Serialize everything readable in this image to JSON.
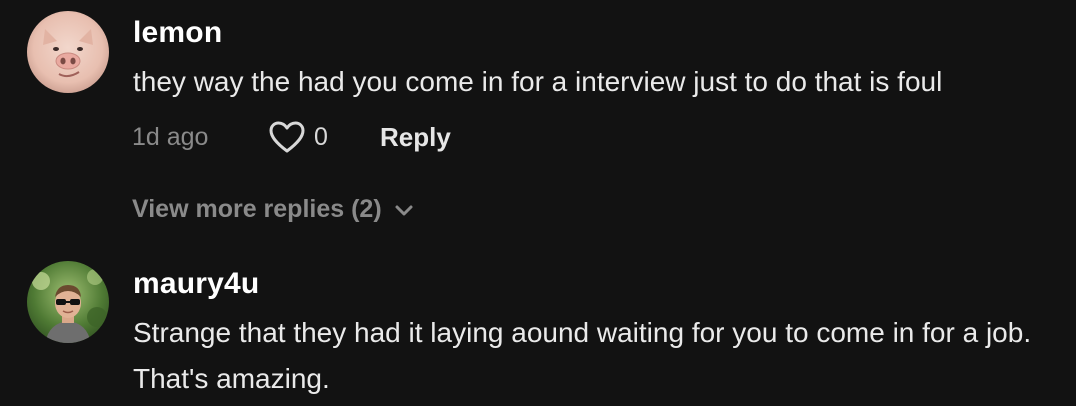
{
  "comments": [
    {
      "username": "lemon",
      "text": "they way the had you come in for a interview just to do that is foul",
      "time": "1d ago",
      "likes": "0",
      "reply_label": "Reply",
      "view_more_label": "View more replies (2)",
      "avatar_icon": "pig-face-avatar"
    },
    {
      "username": "maury4u",
      "text": "Strange that they had it laying aound waiting for you to come in for a job. That's amazing.",
      "avatar_icon": "man-sunglasses-avatar"
    }
  ],
  "colors": {
    "background": "#121212",
    "muted": "#8a8a8a",
    "text": "#eaeaea"
  }
}
